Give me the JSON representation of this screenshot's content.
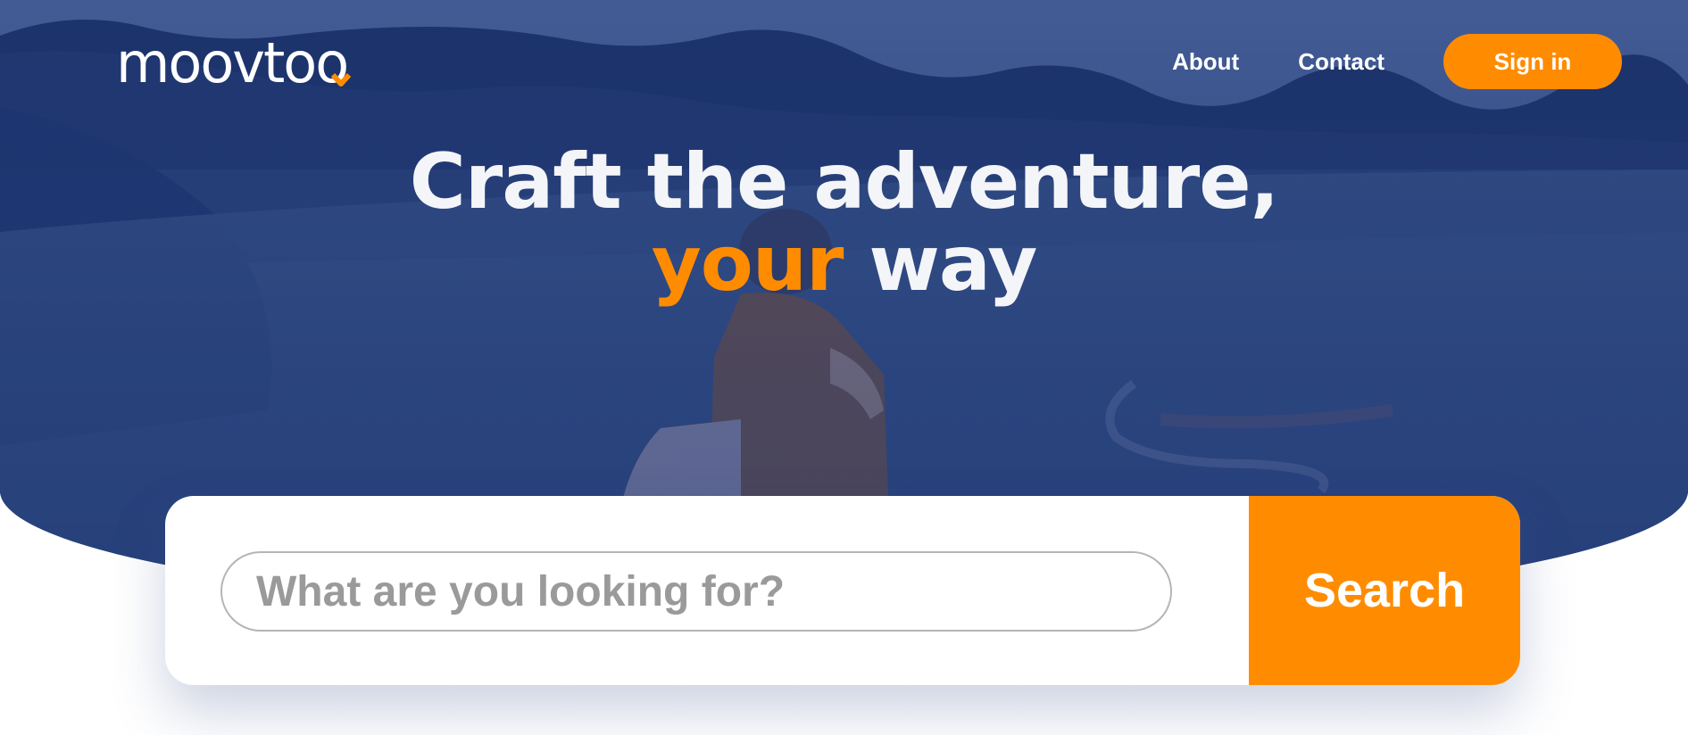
{
  "brand": {
    "name": "moovtoo",
    "accent_color": "#ff8c00",
    "hero_color": "#3c5790"
  },
  "nav": {
    "about_label": "About",
    "contact_label": "Contact",
    "signin_label": "Sign in"
  },
  "hero": {
    "headline_line1": "Craft the adventure,",
    "headline_accent": "your",
    "headline_rest": " way"
  },
  "search": {
    "placeholder": "What are you looking for?",
    "value": "",
    "button_label": "Search"
  },
  "icons": {
    "logo_pin": "map-pin-icon"
  }
}
